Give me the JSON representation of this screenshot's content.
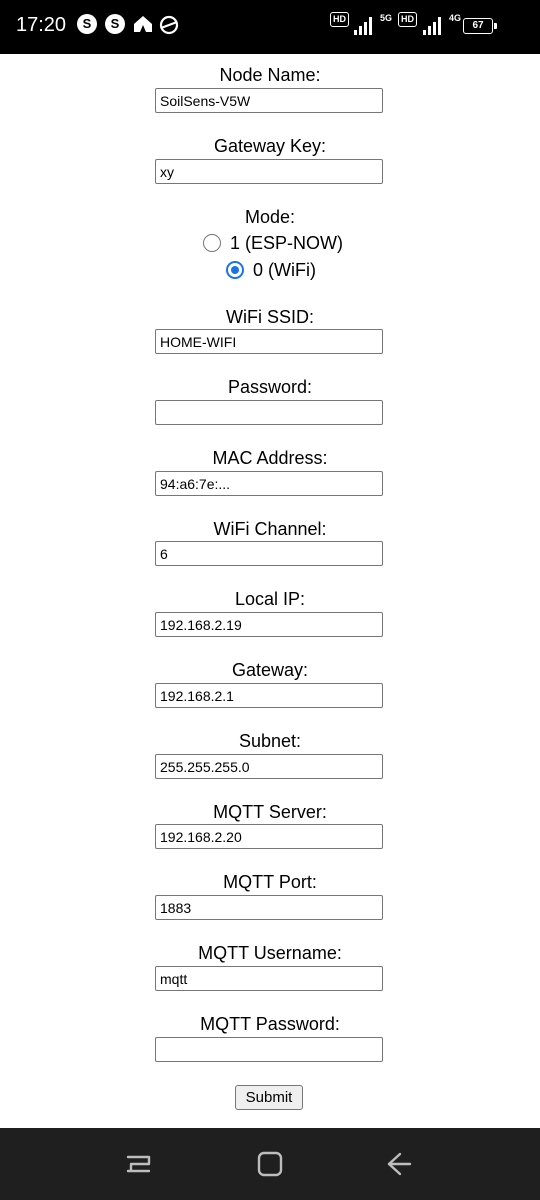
{
  "status_bar": {
    "time": "17:20",
    "notification_icons": [
      "s-icon",
      "s-icon",
      "home-icon",
      "browser-icon"
    ],
    "hd1": "HD",
    "net1": "5G",
    "hd2": "HD",
    "net2": "4G",
    "battery": "67"
  },
  "form": {
    "node_name": {
      "label": "Node Name:",
      "value": "SoilSens-V5W"
    },
    "gateway_key": {
      "label": "Gateway Key:",
      "value": "xy"
    },
    "mode": {
      "label": "Mode:",
      "options": [
        {
          "label": "1 (ESP-NOW)",
          "selected": false
        },
        {
          "label": "0 (WiFi)",
          "selected": true
        }
      ]
    },
    "wifi_ssid": {
      "label": "WiFi SSID:",
      "value": "HOME-WIFI"
    },
    "password": {
      "label": "Password:",
      "value": ""
    },
    "mac_address": {
      "label": "MAC Address:",
      "value": "94:a6:7e:..."
    },
    "wifi_channel": {
      "label": "WiFi Channel:",
      "value": "6"
    },
    "local_ip": {
      "label": "Local IP:",
      "value": "192.168.2.19"
    },
    "gateway": {
      "label": "Gateway:",
      "value": "192.168.2.1"
    },
    "subnet": {
      "label": "Subnet:",
      "value": "255.255.255.0"
    },
    "mqtt_server": {
      "label": "MQTT Server:",
      "value": "192.168.2.20"
    },
    "mqtt_port": {
      "label": "MQTT Port:",
      "value": "1883"
    },
    "mqtt_username": {
      "label": "MQTT Username:",
      "value": "mqtt"
    },
    "mqtt_password": {
      "label": "MQTT Password:",
      "value": ""
    },
    "submit_label": "Submit"
  },
  "nav_bar": {
    "buttons": [
      "recent-apps-icon",
      "home-icon",
      "back-icon"
    ]
  }
}
